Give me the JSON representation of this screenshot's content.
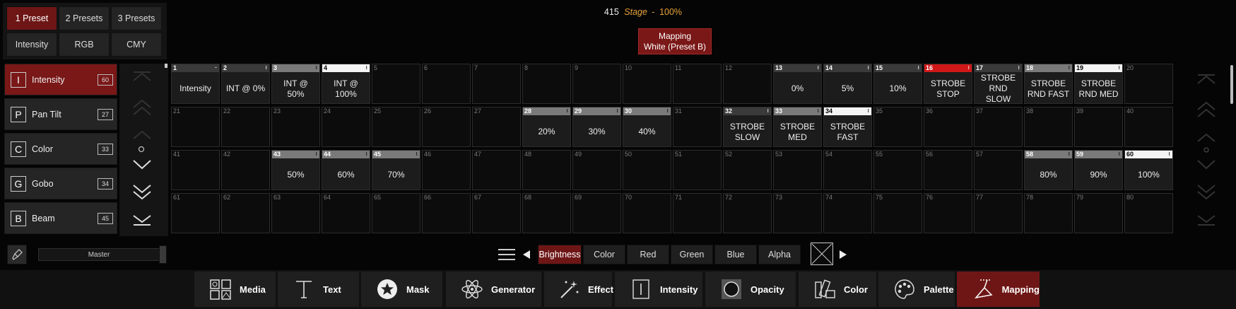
{
  "preset_tabs": [
    {
      "label": "1 Preset",
      "active": true
    },
    {
      "label": "2 Presets",
      "active": false
    },
    {
      "label": "3 Presets",
      "active": false
    },
    {
      "label": "Intensity",
      "active": false
    },
    {
      "label": "RGB",
      "active": false
    },
    {
      "label": "CMY",
      "active": false
    }
  ],
  "attributes": [
    {
      "letter": "I",
      "label": "Intensity",
      "count": "60",
      "active": true
    },
    {
      "letter": "P",
      "label": "Pan Tilt",
      "count": "27",
      "active": false
    },
    {
      "letter": "C",
      "label": "Color",
      "count": "33",
      "active": false
    },
    {
      "letter": "G",
      "label": "Gobo",
      "count": "34",
      "active": false
    },
    {
      "letter": "B",
      "label": "Beam",
      "count": "45",
      "active": false
    }
  ],
  "header": {
    "number": "415",
    "stage": "Stage",
    "sep": "-",
    "zoom": "100%"
  },
  "mapping_badge": {
    "line1": "Mapping",
    "line2": "White (Preset B)"
  },
  "grid": [
    {
      "n": "1",
      "label": "Intensity",
      "bar": "dark",
      "mark": "-"
    },
    {
      "n": "2",
      "label": "INT @ 0%",
      "bar": "dark",
      "mark": "ı"
    },
    {
      "n": "3",
      "label": "INT @ 50%",
      "bar": "gray",
      "mark": "ı"
    },
    {
      "n": "4",
      "label": "INT @ 100%",
      "bar": "white",
      "mark": "ı"
    },
    {
      "n": "5"
    },
    {
      "n": "6"
    },
    {
      "n": "7"
    },
    {
      "n": "8"
    },
    {
      "n": "9"
    },
    {
      "n": "10"
    },
    {
      "n": "11"
    },
    {
      "n": "12"
    },
    {
      "n": "13",
      "label": "0%",
      "bar": "dark",
      "mark": "ı"
    },
    {
      "n": "14",
      "label": "5%",
      "bar": "dark",
      "mark": "ı"
    },
    {
      "n": "15",
      "label": "10%",
      "bar": "dark",
      "mark": "ı"
    },
    {
      "n": "16",
      "label": "STROBE STOP",
      "bar": "red",
      "mark": "ı"
    },
    {
      "n": "17",
      "label": "STROBE RND SLOW",
      "bar": "dark",
      "mark": "ı"
    },
    {
      "n": "18",
      "label": "STROBE RND FAST",
      "bar": "gray",
      "mark": "ı"
    },
    {
      "n": "19",
      "label": "STROBE RND MED",
      "bar": "white",
      "mark": "ı"
    },
    {
      "n": "20"
    },
    {
      "n": "21"
    },
    {
      "n": "22"
    },
    {
      "n": "23"
    },
    {
      "n": "24"
    },
    {
      "n": "25"
    },
    {
      "n": "26"
    },
    {
      "n": "27"
    },
    {
      "n": "28",
      "label": "20%",
      "bar": "gray",
      "mark": "ı"
    },
    {
      "n": "29",
      "label": "30%",
      "bar": "gray",
      "mark": "ı"
    },
    {
      "n": "30",
      "label": "40%",
      "bar": "gray",
      "mark": "ı"
    },
    {
      "n": "31"
    },
    {
      "n": "32",
      "label": "STROBE SLOW",
      "bar": "dark",
      "mark": "ı"
    },
    {
      "n": "33",
      "label": "STROBE MED",
      "bar": "gray",
      "mark": "ı"
    },
    {
      "n": "34",
      "label": "STROBE FAST",
      "bar": "white",
      "mark": "ı"
    },
    {
      "n": "35"
    },
    {
      "n": "36"
    },
    {
      "n": "37"
    },
    {
      "n": "38"
    },
    {
      "n": "39"
    },
    {
      "n": "40"
    },
    {
      "n": "41"
    },
    {
      "n": "42"
    },
    {
      "n": "43",
      "label": "50%",
      "bar": "gray",
      "mark": "ı"
    },
    {
      "n": "44",
      "label": "60%",
      "bar": "gray",
      "mark": "ı"
    },
    {
      "n": "45",
      "label": "70%",
      "bar": "gray",
      "mark": "ı"
    },
    {
      "n": "46"
    },
    {
      "n": "47"
    },
    {
      "n": "48"
    },
    {
      "n": "49"
    },
    {
      "n": "50"
    },
    {
      "n": "51"
    },
    {
      "n": "52"
    },
    {
      "n": "53"
    },
    {
      "n": "54"
    },
    {
      "n": "55"
    },
    {
      "n": "56"
    },
    {
      "n": "57"
    },
    {
      "n": "58",
      "label": "80%",
      "bar": "gray",
      "mark": "ı"
    },
    {
      "n": "59",
      "label": "90%",
      "bar": "gray",
      "mark": "ı"
    },
    {
      "n": "60",
      "label": "100%",
      "bar": "white",
      "mark": "ı"
    },
    {
      "n": "61"
    },
    {
      "n": "62"
    },
    {
      "n": "63"
    },
    {
      "n": "64"
    },
    {
      "n": "65"
    },
    {
      "n": "66"
    },
    {
      "n": "67"
    },
    {
      "n": "68"
    },
    {
      "n": "69"
    },
    {
      "n": "70"
    },
    {
      "n": "71"
    },
    {
      "n": "72"
    },
    {
      "n": "73"
    },
    {
      "n": "74"
    },
    {
      "n": "75"
    },
    {
      "n": "76"
    },
    {
      "n": "77"
    },
    {
      "n": "78"
    },
    {
      "n": "79"
    },
    {
      "n": "80"
    }
  ],
  "master": {
    "label": "Master"
  },
  "channel_tabs": [
    {
      "label": "Brightness",
      "active": true
    },
    {
      "label": "Color",
      "active": false
    },
    {
      "label": "Red",
      "active": false
    },
    {
      "label": "Green",
      "active": false
    },
    {
      "label": "Blue",
      "active": false
    },
    {
      "label": "Alpha",
      "active": false
    }
  ],
  "toolbar": [
    {
      "label": "Media",
      "icon": "media-icon",
      "active": false
    },
    {
      "label": "Text",
      "icon": "text-icon",
      "active": false
    },
    {
      "label": "Mask",
      "icon": "mask-icon",
      "active": false
    },
    {
      "label": "Generator",
      "icon": "generator-icon",
      "active": false
    },
    {
      "label": "Effect",
      "icon": "effect-icon",
      "active": false
    },
    {
      "label": "Intensity",
      "icon": "intensity-icon",
      "active": false
    },
    {
      "label": "Opacity",
      "icon": "opacity-icon",
      "active": false
    },
    {
      "label": "Color",
      "icon": "color-icon",
      "active": false
    },
    {
      "label": "Palette",
      "icon": "palette-icon",
      "active": false
    },
    {
      "label": "Mapping",
      "icon": "mapping-icon",
      "active": true
    }
  ],
  "colors": {
    "accent": "#6e1616",
    "stage_text": "#e8a23a",
    "strobe_red": "#d01818"
  }
}
